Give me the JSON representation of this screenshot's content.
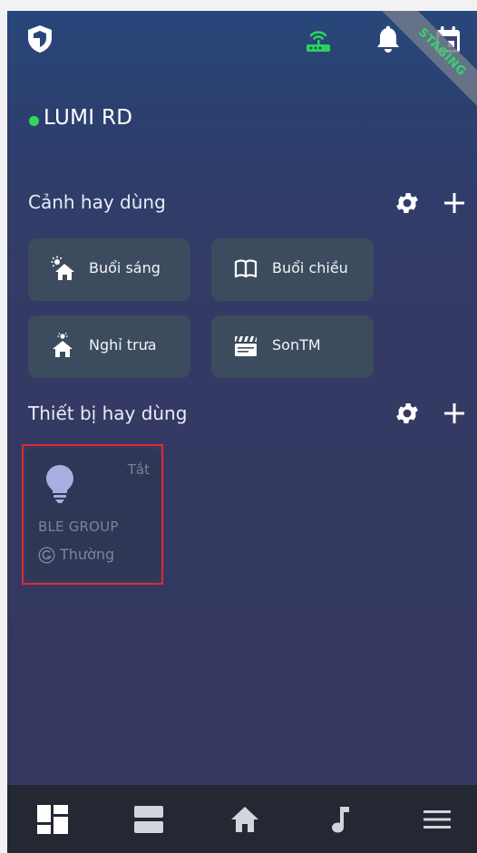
{
  "topbar": {
    "shield_icon": "shield-icon",
    "gateway_icon": "router-wifi-icon",
    "notification_icon": "bell-icon",
    "calendar_icon": "calendar-icon",
    "environment_ribbon": "STAGING",
    "colors": {
      "gateway_online": "#2bd25a",
      "ribbon_text": "#35d36b"
    }
  },
  "home": {
    "name": "LUMI RD",
    "status_color": "#33d65c"
  },
  "scenes_section": {
    "title": "Cảnh hay dùng",
    "settings_icon": "gear-icon",
    "add_icon": "plus-icon",
    "items": [
      {
        "label": "Buổi sáng",
        "icon": "sunrise-house-icon"
      },
      {
        "label": "Buổi chiều",
        "icon": "open-book-icon"
      },
      {
        "label": "Nghỉ trưa",
        "icon": "noon-house-icon"
      },
      {
        "label": "SonTM",
        "icon": "clapperboard-icon"
      }
    ]
  },
  "devices_section": {
    "title": "Thiết bị hay dùng",
    "settings_icon": "gear-icon",
    "add_icon": "plus-icon",
    "items": [
      {
        "name": "BLE GROUP",
        "state": "Tắt",
        "type": "Thường",
        "icon": "light-bulb-icon",
        "type_icon": "group-g-icon"
      }
    ]
  },
  "bottom_nav": {
    "items": [
      {
        "icon": "dashboard-icon",
        "active": true
      },
      {
        "icon": "rooms-icon",
        "active": false
      },
      {
        "icon": "home-icon",
        "active": false
      },
      {
        "icon": "music-note-icon",
        "active": false
      },
      {
        "icon": "menu-icon",
        "active": false
      }
    ]
  }
}
